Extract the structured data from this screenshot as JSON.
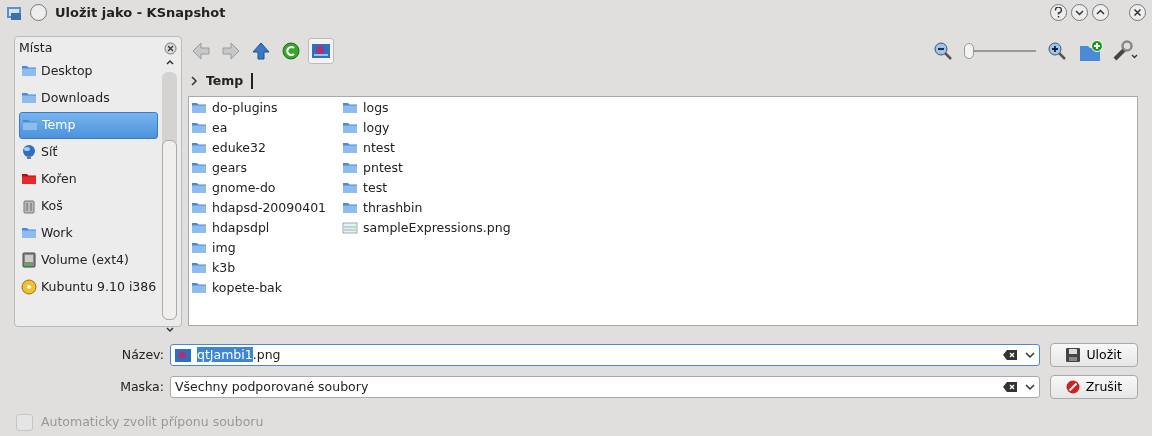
{
  "window": {
    "title": "Uložit jako - KSnapshot"
  },
  "sidebar": {
    "title": "Místa",
    "items": [
      {
        "label": "Desktop",
        "kind": "folder",
        "selected": false
      },
      {
        "label": "Downloads",
        "kind": "folder",
        "selected": false
      },
      {
        "label": "Temp",
        "kind": "folder",
        "selected": true
      },
      {
        "label": "Síť",
        "kind": "network",
        "selected": false
      },
      {
        "label": "Kořen",
        "kind": "root",
        "selected": false
      },
      {
        "label": "Koš",
        "kind": "trash",
        "selected": false
      },
      {
        "label": "Work",
        "kind": "folder",
        "selected": false
      },
      {
        "label": "Volume (ext4)",
        "kind": "drive",
        "selected": false
      },
      {
        "label": "Kubuntu 9.10 i386",
        "kind": "disc",
        "selected": false
      }
    ]
  },
  "toolbar": {
    "back_disabled": true,
    "forward_disabled": true,
    "preview_on": true,
    "zoom": {
      "level": 0.0
    }
  },
  "breadcrumb": {
    "items": [
      "Temp"
    ]
  },
  "files": [
    {
      "name": "do-plugins",
      "kind": "folder"
    },
    {
      "name": "ea",
      "kind": "folder"
    },
    {
      "name": "eduke32",
      "kind": "folder"
    },
    {
      "name": "gears",
      "kind": "folder"
    },
    {
      "name": "gnome-do",
      "kind": "folder"
    },
    {
      "name": "hdapsd-20090401",
      "kind": "folder"
    },
    {
      "name": "hdapsdpl",
      "kind": "folder"
    },
    {
      "name": "img",
      "kind": "folder"
    },
    {
      "name": "k3b",
      "kind": "folder"
    },
    {
      "name": "kopete-bak",
      "kind": "folder"
    },
    {
      "name": "logs",
      "kind": "folder"
    },
    {
      "name": "logy",
      "kind": "folder"
    },
    {
      "name": "ntest",
      "kind": "folder"
    },
    {
      "name": "pntest",
      "kind": "folder"
    },
    {
      "name": "test",
      "kind": "folder"
    },
    {
      "name": "thrashbin",
      "kind": "folder"
    },
    {
      "name": "sampleExpressions.png",
      "kind": "image"
    }
  ],
  "name_field": {
    "label": "Název:",
    "selected_text": "qtJambi1",
    "text_after": ".png"
  },
  "filter_field": {
    "label": "Maska:",
    "value": "Všechny podporované soubory"
  },
  "buttons": [
    {
      "label": "Uložit",
      "kind": "save"
    },
    {
      "label": "Zrušit",
      "kind": "cancel"
    }
  ],
  "auto_extension": {
    "label": "Automaticky zvolit příponu souboru",
    "checked": false,
    "disabled": true
  }
}
